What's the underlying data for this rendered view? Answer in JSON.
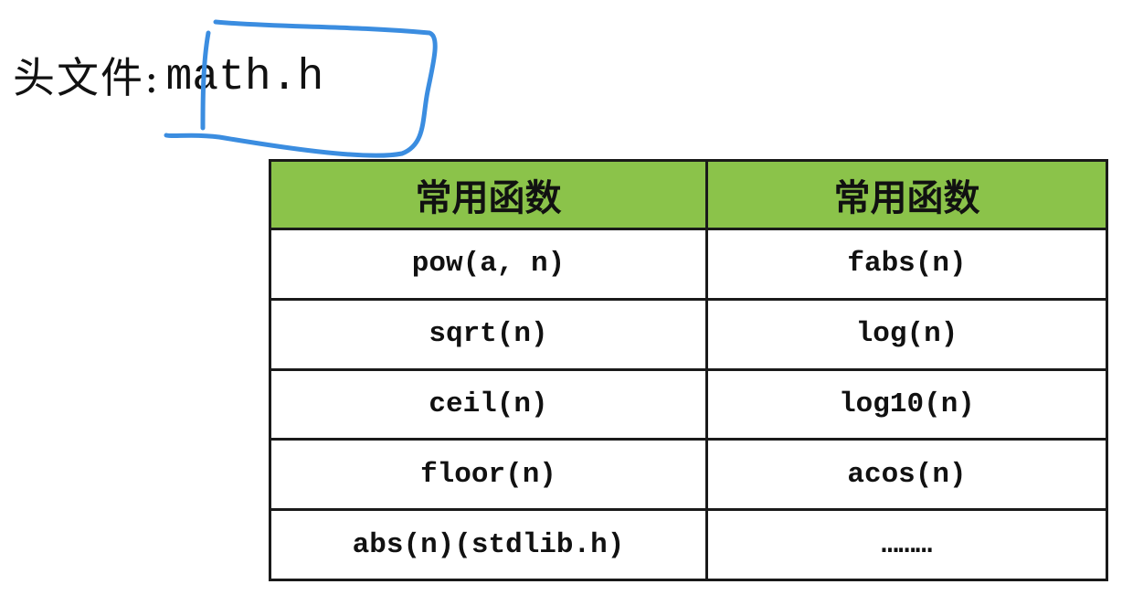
{
  "header": {
    "label": "头文件:",
    "value": "math.h"
  },
  "annotation": {
    "color": "#3b8de0",
    "shape": "hand-drawn-box"
  },
  "table": {
    "header_bg": "#8bc34a",
    "columns": [
      "常用函数",
      "常用函数"
    ],
    "rows": [
      [
        "pow(a, n)",
        "fabs(n)"
      ],
      [
        "sqrt(n)",
        "log(n)"
      ],
      [
        "ceil(n)",
        "log10(n)"
      ],
      [
        "floor(n)",
        "acos(n)"
      ],
      [
        "abs(n)(stdlib.h)",
        "………"
      ]
    ]
  }
}
